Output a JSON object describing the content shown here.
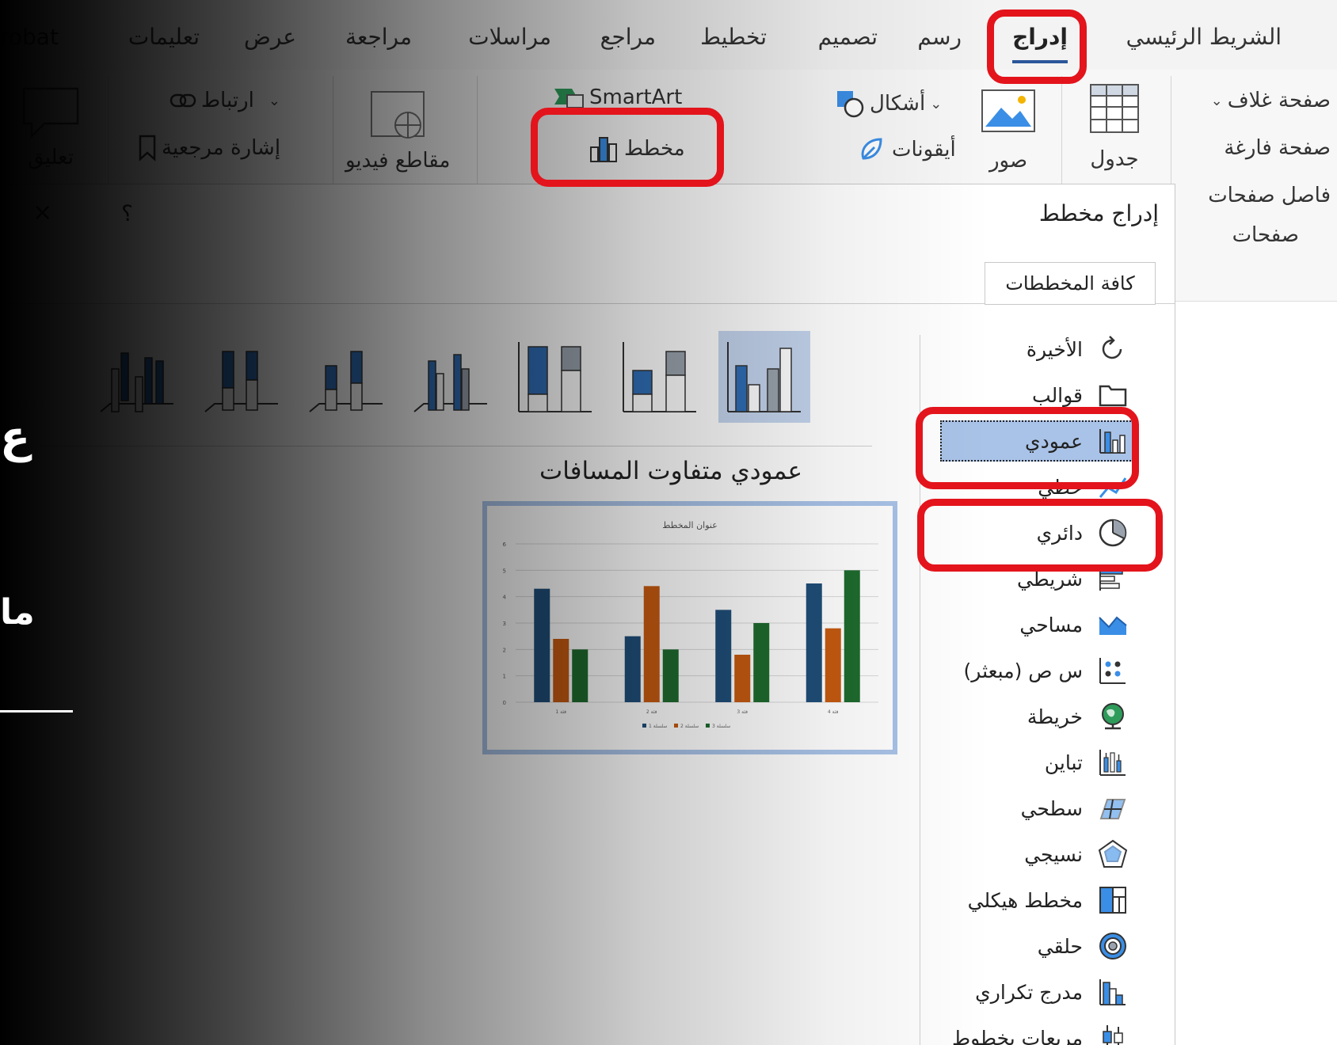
{
  "tabs": {
    "home": "الشريط الرئيسي",
    "insert": "إدراج",
    "draw": "رسم",
    "design": "تصميم",
    "layout": "تخطيط",
    "references": "مراجع",
    "mailings": "مراسلات",
    "review": "مراجعة",
    "view": "عرض",
    "help": "تعليمات",
    "acrobat_cut": "robat"
  },
  "ribbon": {
    "cover_page": "صفحة غلاف",
    "blank_page": "صفحة فارغة",
    "page_break": "فاصل صفحات",
    "pages_group": "صفحات",
    "table": "جدول",
    "pictures": "صور",
    "shapes": "أشكال",
    "icons": "أيقونات",
    "smartart": "SmartArt",
    "chart": "مخطط",
    "online_video": "مقاطع فيديو",
    "link": "ارتباط",
    "bookmark": "إشارة مرجعية",
    "comment": "تعليق"
  },
  "dialog": {
    "title": "إدراج مخطط",
    "help": "؟",
    "close": "×",
    "all_charts_tab": "كافة المخططات",
    "chart_types": [
      {
        "label": "الأخيرة",
        "icon": "recent-icon"
      },
      {
        "label": "قوالب",
        "icon": "folder-icon"
      },
      {
        "label": "عمودي",
        "icon": "column-chart-icon",
        "selected": true
      },
      {
        "label": "خطي",
        "icon": "line-chart-icon"
      },
      {
        "label": "دائري",
        "icon": "pie-chart-icon"
      },
      {
        "label": "شريطي",
        "icon": "bar-chart-icon"
      },
      {
        "label": "مساحي",
        "icon": "area-chart-icon"
      },
      {
        "label": "س ص (مبعثر)",
        "icon": "scatter-chart-icon"
      },
      {
        "label": "خريطة",
        "icon": "map-chart-icon"
      },
      {
        "label": "تباين",
        "icon": "stock-chart-icon"
      },
      {
        "label": "سطحي",
        "icon": "surface-chart-icon"
      },
      {
        "label": "نسيجي",
        "icon": "radar-chart-icon"
      },
      {
        "label": "مخطط هيكلي",
        "icon": "treemap-chart-icon"
      },
      {
        "label": "حلقي",
        "icon": "sunburst-chart-icon"
      },
      {
        "label": "مدرج تكراري",
        "icon": "histogram-chart-icon"
      },
      {
        "label": "مربعات بخطوط",
        "icon": "box-whisker-chart-icon"
      }
    ],
    "selected_subtype_title": "عمودي متفاوت المسافات",
    "preview": {
      "title": "عنوان المخطط"
    }
  },
  "background_text": {
    "line1": "ع",
    "line2": "ما"
  },
  "colors": {
    "highlight": "#e3141c",
    "selection": "#a9c3e8",
    "accent": "#2b579a",
    "series1": "#1f4e79",
    "series2": "#c55a11",
    "series3": "#1e6b2e"
  },
  "chart_data": {
    "type": "bar",
    "title": "عنوان المخطط",
    "categories": [
      "فئة 1",
      "فئة 2",
      "فئة 3",
      "فئة 4"
    ],
    "series": [
      {
        "name": "سلسلة 1",
        "values": [
          4.3,
          2.5,
          3.5,
          4.5
        ]
      },
      {
        "name": "سلسلة 2",
        "values": [
          2.4,
          4.4,
          1.8,
          2.8
        ]
      },
      {
        "name": "سلسلة 3",
        "values": [
          2,
          2,
          3,
          5
        ]
      }
    ],
    "ylim": [
      0,
      6
    ],
    "yticks": [
      "0",
      "1",
      "2",
      "3",
      "4",
      "5",
      "6"
    ],
    "grid": true,
    "legend": "bottom"
  }
}
